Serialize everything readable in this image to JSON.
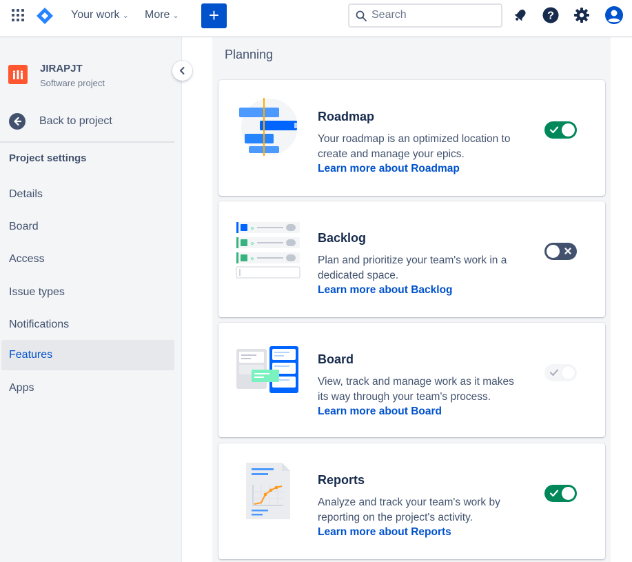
{
  "topnav": {
    "your_work": "Your work",
    "more": "More",
    "create": "+",
    "search_placeholder": "Search"
  },
  "sidebar": {
    "project_name": "JIRAPJT",
    "project_type": "Software project",
    "back": "Back to project",
    "heading": "Project settings",
    "items": [
      {
        "label": "Details"
      },
      {
        "label": "Board"
      },
      {
        "label": "Access"
      },
      {
        "label": "Issue types"
      },
      {
        "label": "Notifications"
      },
      {
        "label": "Features",
        "active": true
      },
      {
        "label": "Apps"
      }
    ]
  },
  "main": {
    "section": "Planning",
    "features": [
      {
        "title": "Roadmap",
        "desc": "Your roadmap is an optimized location to create and manage your epics.",
        "link": "Learn more about Roadmap",
        "toggle": "on"
      },
      {
        "title": "Backlog",
        "desc": "Plan and prioritize your team's work in a dedicated space.",
        "link": "Learn more about Backlog",
        "toggle": "off"
      },
      {
        "title": "Board",
        "desc": "View, track and manage work as it makes its way through your team's process.",
        "link": "Learn more about Board",
        "toggle": "disabled"
      },
      {
        "title": "Reports",
        "desc": "Analyze and track your team's work by reporting on the project's activity.",
        "link": "Learn more about Reports",
        "toggle": "on"
      }
    ]
  },
  "colors": {
    "brand_blue": "#0052cc",
    "toggle_on": "#00875a",
    "toggle_off": "#42526e",
    "project_avatar": "#ff5630"
  }
}
